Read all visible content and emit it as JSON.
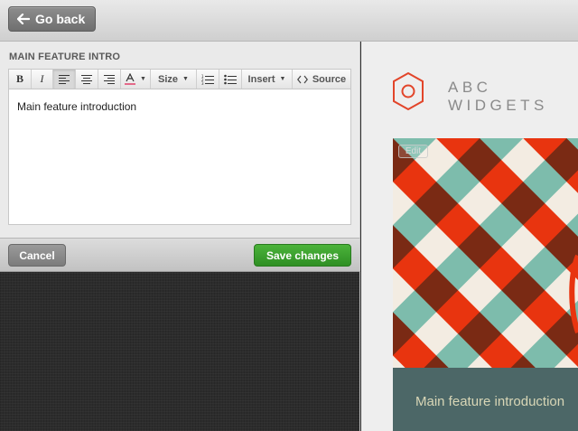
{
  "topbar": {
    "go_back_label": "Go back"
  },
  "editor": {
    "section_title": "MAIN FEATURE INTRO",
    "toolbar": {
      "bold_icon": "bold-icon",
      "italic_icon": "italic-icon",
      "align_left_icon": "align-left-icon",
      "align_center_icon": "align-center-icon",
      "align_right_icon": "align-right-icon",
      "text_color_icon": "text-color-icon",
      "size_label": "Size",
      "ordered_list_icon": "ordered-list-icon",
      "unordered_list_icon": "unordered-list-icon",
      "insert_label": "Insert",
      "source_label": "Source"
    },
    "content": "Main feature introduction"
  },
  "actions": {
    "cancel_label": "Cancel",
    "save_label": "Save changes"
  },
  "preview": {
    "brand_line1": "ABC",
    "brand_line2": "WIDGETS",
    "edit_label": "Edit",
    "intro_text": "Main feature introduction"
  },
  "colors": {
    "accent_green": "#3aa12d",
    "brand_red": "#e2452a",
    "hero_teal": "#7dbcac",
    "hero_red": "#e8340f",
    "hero_brown": "#7a2a14",
    "hero_cream": "#f3ece2",
    "band_slate": "#4c6767"
  }
}
